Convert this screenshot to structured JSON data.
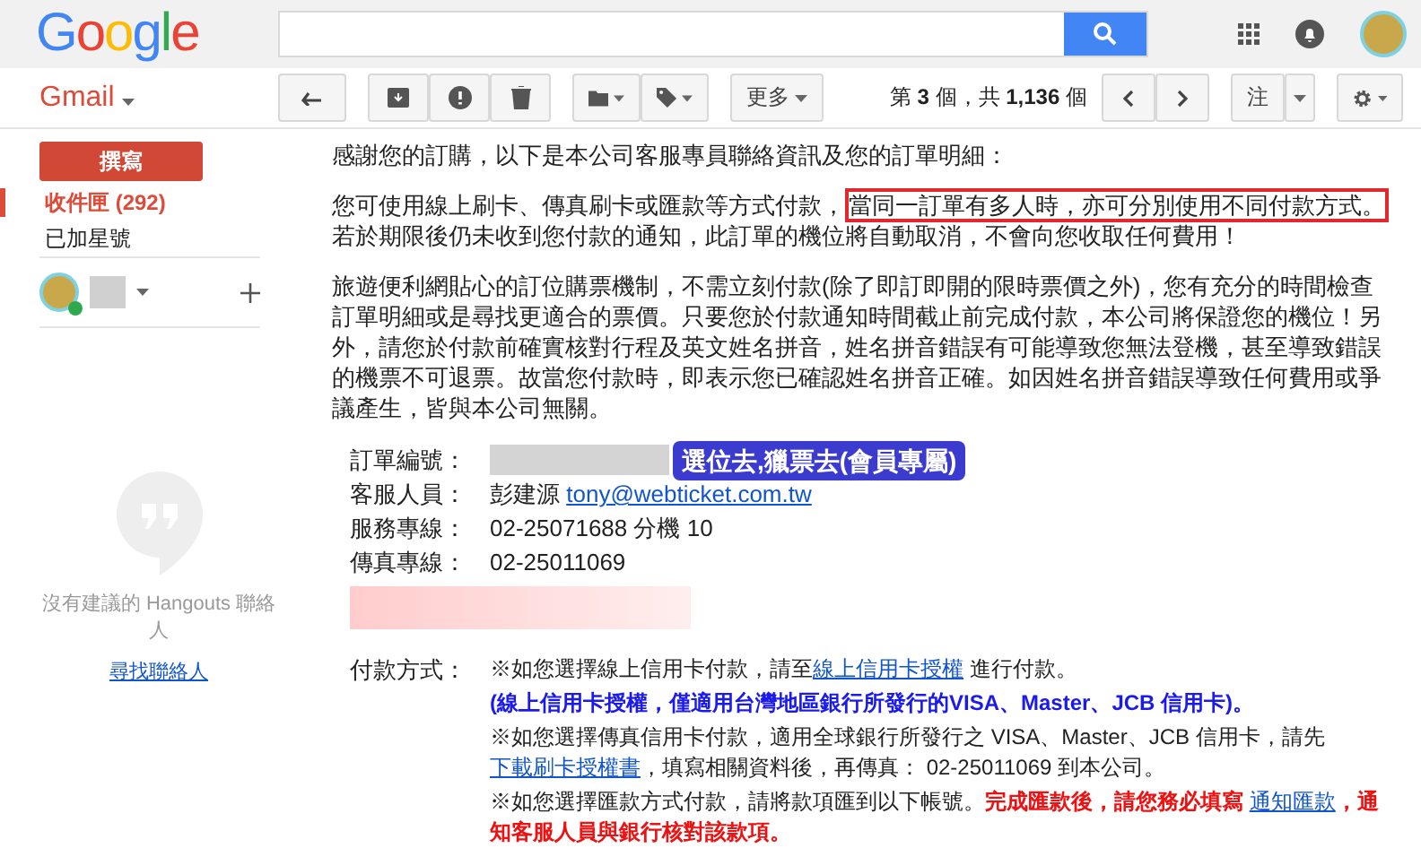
{
  "header": {
    "logo": "Google"
  },
  "toolbar": {
    "app_menu": "Gmail",
    "more": "更多",
    "count": "第 **3** 個，共 **1,136** 個",
    "note": "注"
  },
  "sidebar": {
    "compose": "撰寫",
    "items": [
      {
        "label": "收件匣 (292)",
        "selected": true
      },
      {
        "label": "已加星號",
        "selected": false
      }
    ],
    "hangouts": {
      "empty": "沒有建議的 Hangouts 聯絡人",
      "link": "尋找聯絡人"
    }
  },
  "email": {
    "intro": "感謝您的訂購，以下是本公司客服專員聯絡資訊及您的訂單明細：",
    "payment_para": {
      "before": "您可使用線上刷卡、傳真刷卡或匯款等方式付款，",
      "highlight": "當同一訂單有多人時，亦可分別使用不同付款方式。",
      "after": "若於期限後仍未收到您付款的通知，此訂單的機位將自動取消，不會向您收取任何費用！"
    },
    "policy": "旅遊便利網貼心的訂位購票機制，不需立刻付款(除了即訂即開的限時票價之外)，您有充分的時間檢查訂單明細或是尋找更適合的票價。只要您於付款通知時間截止前完成付款，本公司將保證您的機位！另外，請您於付款前確實核對行程及英文姓名拼音，姓名拼音錯誤有可能導致您無法登機，甚至導致錯誤的機票不可退票。故當您付款時，即表示您已確認姓名拼音正確。如因姓名拼音錯誤導致任何費用或爭議產生，皆與本公司無關。",
    "badge": "選位去,獵票去(會員專屬)",
    "fields": [
      {
        "label": "訂單編號：",
        "kind": "redacted"
      },
      {
        "label": "客服人員：",
        "kind": "contact",
        "value": "彭建源",
        "link": "tony@webticket.com.tw"
      },
      {
        "label": "服務專線：",
        "kind": "text",
        "value": "02-25071688 分機 10"
      },
      {
        "label": "傳真專線：",
        "kind": "text",
        "value": "02-25011069"
      }
    ],
    "payment_label": "付款方式：",
    "payment_lines": [
      [
        {
          "kind": "text",
          "text": "※如您選擇線上信用卡付款，請至"
        },
        {
          "kind": "link",
          "text": "線上信用卡授權"
        },
        {
          "kind": "text",
          "text": " 進行付款。"
        }
      ],
      [
        {
          "kind": "blue",
          "text": "(線上信用卡授權，僅適用台灣地區銀行所發行的VISA、Master、JCB 信用卡)。"
        }
      ],
      [
        {
          "kind": "text",
          "text": "※如您選擇傳真信用卡付款，適用全球銀行所發行之 VISA、Master、JCB 信用卡，請先"
        },
        {
          "kind": "link",
          "text": "下載刷卡授權書"
        },
        {
          "kind": "text",
          "text": "，填寫相關資料後，再傳真： 02-25011069 到本公司。"
        }
      ],
      [
        {
          "kind": "text",
          "text": "※如您選擇匯款方式付款，請將款項匯到以下帳號。"
        },
        {
          "kind": "red",
          "text": "完成匯款後，請您務必填寫 "
        },
        {
          "kind": "link",
          "text": "通知匯款"
        },
        {
          "kind": "red",
          "text": "，通知客服人員與銀行核對該款項。"
        }
      ]
    ]
  }
}
